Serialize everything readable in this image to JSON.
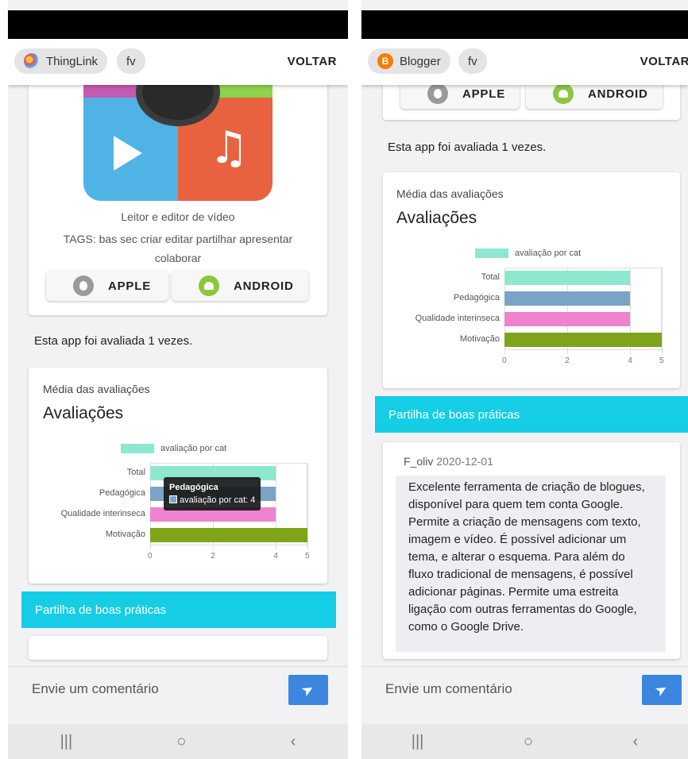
{
  "left": {
    "chips": [
      "ThingLink",
      "fv"
    ],
    "voltar": "VOLTAR",
    "app_card": {
      "description": "Leitor e editor de vídeo",
      "tags": "TAGS: bas sec criar editar partilhar apresentar colaborar",
      "apple": "APPLE",
      "android": "ANDROID"
    },
    "rated_text": "Esta app foi avaliada 1 vezes.",
    "ratings": {
      "subtitle": "Média das avaliações",
      "title": "Avaliações",
      "tooltip_title": "Pedagógica",
      "tooltip_value": "avaliação por cat: 4"
    },
    "good_practices": "Partilha de boas práticas",
    "comment_placeholder": "Envie um comentário"
  },
  "right": {
    "chips": [
      "Blogger",
      "fv"
    ],
    "voltar": "VOLTAR",
    "apple": "APPLE",
    "android": "ANDROID",
    "rated_text": "Esta app foi avaliada 1 vezes.",
    "ratings": {
      "subtitle": "Média das avaliações",
      "title": "Avaliações"
    },
    "good_practices": "Partilha de boas práticas",
    "review": {
      "author": "F_oliv",
      "date": "2020-12-01",
      "text": "Excelente ferramenta de criação de blogues, disponível para quem tem conta Google. Permite a criação de mensagens com texto, imagem e vídeo. É possível adicionar um tema, e alterar o esquema. Para além do fluxo tradicional de mensagens, é possível adicionar páginas. Permite uma estreita ligação com outras ferramentas do Google, como o Google Drive."
    },
    "comment_placeholder": "Envie um comentário"
  },
  "navbar": {
    "recent": "|||",
    "home": "○",
    "back": "‹"
  },
  "colors": {
    "accent_blue_band": "#16cde6",
    "send_button": "#3d86e0",
    "legend_mint": "#8ee8d0"
  },
  "chart_data": [
    {
      "type": "bar",
      "orientation": "horizontal",
      "categories": [
        "Total",
        "Pedagógica",
        "Qualidade interinseca",
        "Motivação"
      ],
      "series": [
        {
          "name": "avaliação por cat",
          "values": [
            4,
            4,
            4,
            5
          ],
          "colors": [
            "#8ee8d0",
            "#7aa3c6",
            "#ee82cf",
            "#7ea41a"
          ]
        }
      ],
      "xticks": [
        0,
        2,
        4,
        5
      ],
      "xlim": [
        0,
        5
      ],
      "legend": "top"
    },
    {
      "type": "bar",
      "orientation": "horizontal",
      "categories": [
        "Total",
        "Pedagógica",
        "Qualidade interinseca",
        "Motivação"
      ],
      "series": [
        {
          "name": "avaliação por cat",
          "values": [
            4,
            4,
            4,
            5
          ],
          "colors": [
            "#8ee8d0",
            "#7aa3c6",
            "#ee82cf",
            "#7ea41a"
          ]
        }
      ],
      "xticks": [
        0,
        2,
        4,
        5
      ],
      "xlim": [
        0,
        5
      ],
      "legend": "top"
    }
  ]
}
